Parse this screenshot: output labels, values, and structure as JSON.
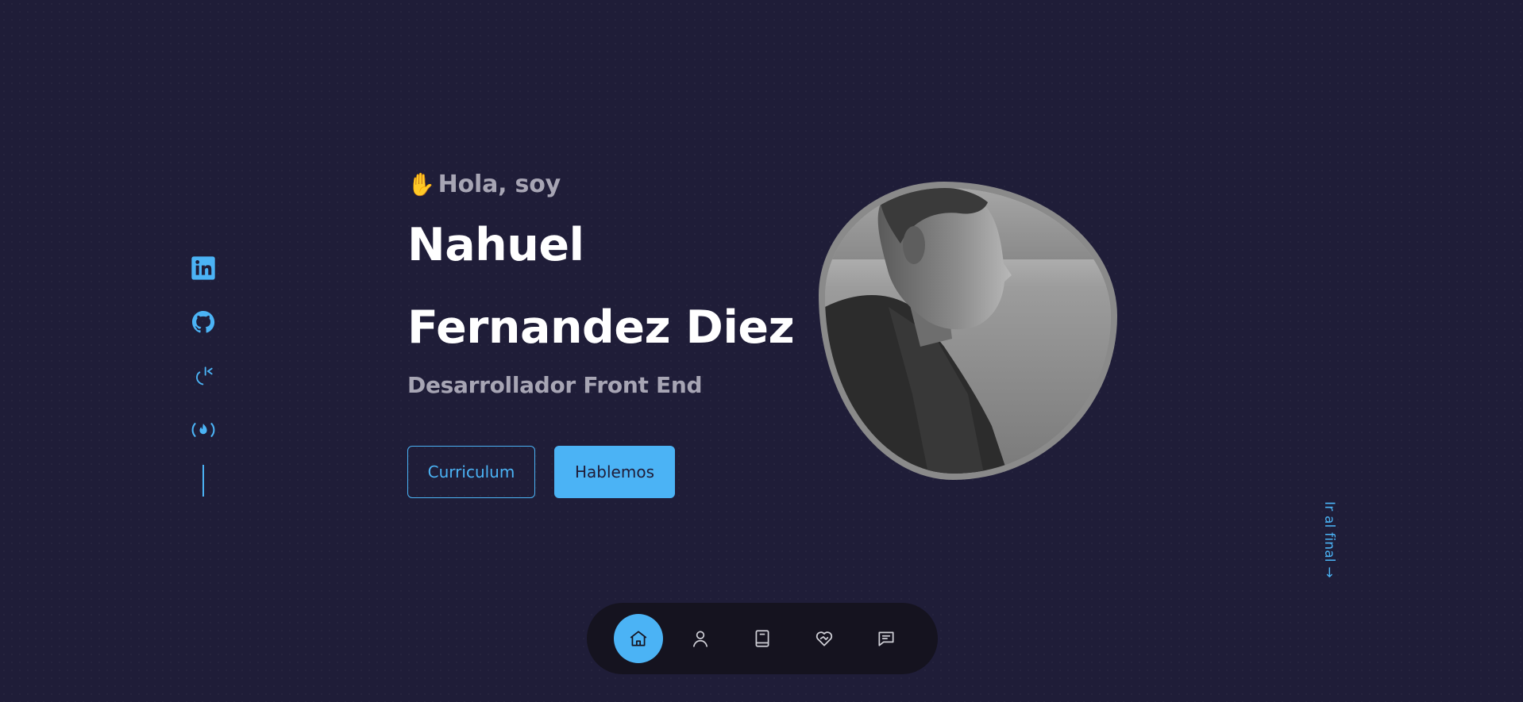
{
  "hero": {
    "greeting_emoji": "✋",
    "greeting": "Hola, soy",
    "name_line1": "Nahuel",
    "name_line2": "Fernandez Diez",
    "role": "Desarrollador Front End"
  },
  "buttons": {
    "cv": "Curriculum",
    "contact": "Hablemos"
  },
  "social": [
    {
      "icon": "linkedin-icon"
    },
    {
      "icon": "github-icon"
    },
    {
      "icon": "codewars-icon"
    },
    {
      "icon": "freecodecamp-icon"
    }
  ],
  "scroll_link": "Ir al final →",
  "nav": [
    {
      "icon": "home-icon",
      "active": true
    },
    {
      "icon": "user-icon",
      "active": false
    },
    {
      "icon": "book-icon",
      "active": false
    },
    {
      "icon": "handshake-heart-icon",
      "active": false
    },
    {
      "icon": "message-icon",
      "active": false
    }
  ],
  "colors": {
    "background": "#1f1d38",
    "accent": "#4bb3f5",
    "muted_text": "#a7a5b4",
    "nav_background": "#15131f"
  }
}
